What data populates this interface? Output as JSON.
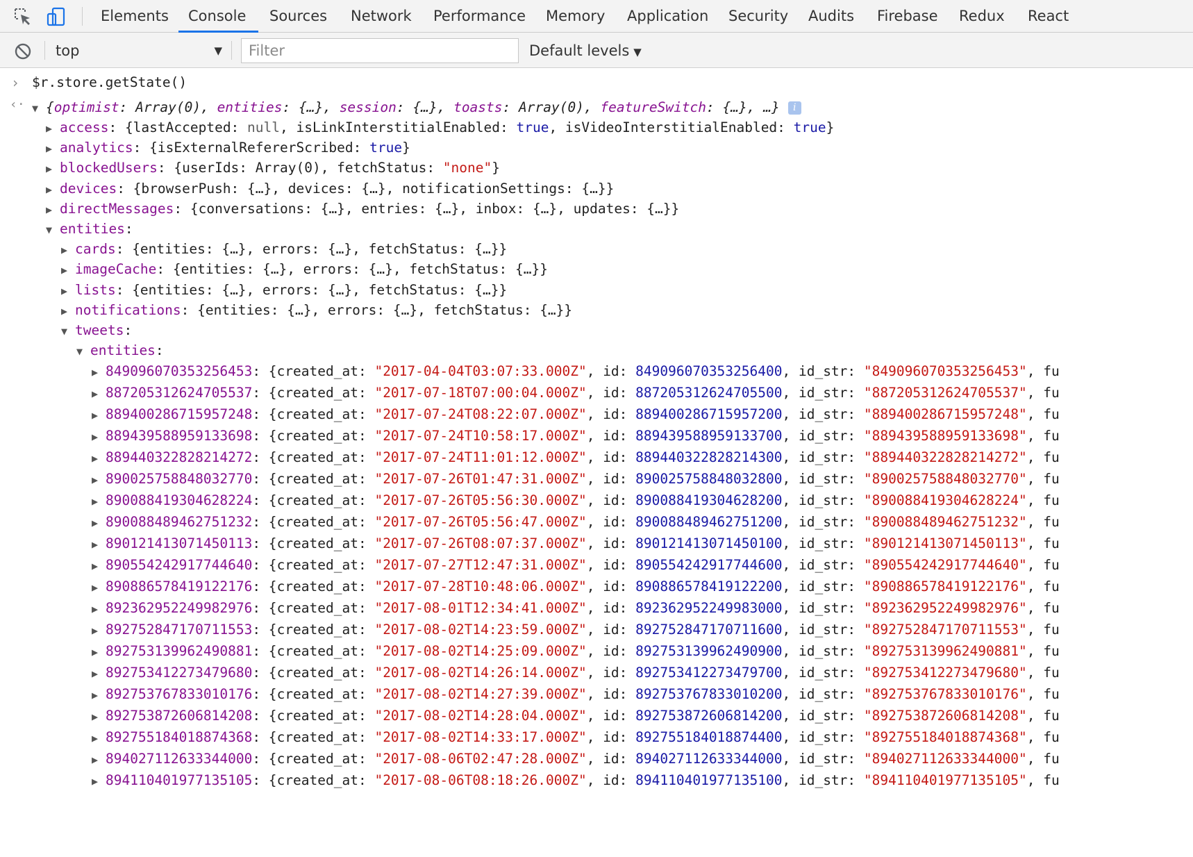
{
  "tabs": [
    "Elements",
    "Console",
    "Sources",
    "Network",
    "Performance",
    "Memory",
    "Application",
    "Security",
    "Audits",
    "Firebase",
    "Redux",
    "React"
  ],
  "active_tab": "Console",
  "toolbar": {
    "context": "top",
    "filter_placeholder": "Filter",
    "levels": "Default levels"
  },
  "command": "$r.store.getState()",
  "summary": {
    "open": "{",
    "parts": [
      {
        "key": "optimist",
        "val": "Array(0)"
      },
      {
        "key": "entities",
        "val": "{…}"
      },
      {
        "key": "session",
        "val": "{…}"
      },
      {
        "key": "toasts",
        "val": "Array(0)"
      },
      {
        "key": "featureSwitch",
        "val": "{…}"
      }
    ],
    "close": ", …}"
  },
  "top_props": [
    {
      "key": "access",
      "text": "{lastAccepted: null, isLinkInterstitialEnabled: true, isVideoInterstitialEnabled: true}"
    },
    {
      "key": "analytics",
      "text": "{isExternalRefererScribed: true}"
    },
    {
      "key": "blockedUsers",
      "text": "{userIds: Array(0), fetchStatus: \"none\"}"
    },
    {
      "key": "devices",
      "text": "{browserPush: {…}, devices: {…}, notificationSettings: {…}}"
    },
    {
      "key": "directMessages",
      "text": "{conversations: {…}, entries: {…}, inbox: {…}, updates: {…}}"
    }
  ],
  "entities_label": "entities",
  "entity_children": [
    {
      "key": "cards",
      "text": "{entities: {…}, errors: {…}, fetchStatus: {…}}"
    },
    {
      "key": "imageCache",
      "text": "{entities: {…}, errors: {…}, fetchStatus: {…}}"
    },
    {
      "key": "lists",
      "text": "{entities: {…}, errors: {…}, fetchStatus: {…}}"
    },
    {
      "key": "notifications",
      "text": "{entities: {…}, errors: {…}, fetchStatus: {…}}"
    }
  ],
  "tweets_label": "tweets",
  "tweets_entities_label": "entities",
  "tweets": [
    {
      "key": "849096070353256453",
      "created_at": "\"2017-04-04T03:07:33.000Z\"",
      "id": "849096070353256400",
      "id_str": "\"849096070353256453\""
    },
    {
      "key": "887205312624705537",
      "created_at": "\"2017-07-18T07:00:04.000Z\"",
      "id": "887205312624705500",
      "id_str": "\"887205312624705537\""
    },
    {
      "key": "889400286715957248",
      "created_at": "\"2017-07-24T08:22:07.000Z\"",
      "id": "889400286715957200",
      "id_str": "\"889400286715957248\""
    },
    {
      "key": "889439588959133698",
      "created_at": "\"2017-07-24T10:58:17.000Z\"",
      "id": "889439588959133700",
      "id_str": "\"889439588959133698\""
    },
    {
      "key": "889440322828214272",
      "created_at": "\"2017-07-24T11:01:12.000Z\"",
      "id": "889440322828214300",
      "id_str": "\"889440322828214272\""
    },
    {
      "key": "890025758848032770",
      "created_at": "\"2017-07-26T01:47:31.000Z\"",
      "id": "890025758848032800",
      "id_str": "\"890025758848032770\""
    },
    {
      "key": "890088419304628224",
      "created_at": "\"2017-07-26T05:56:30.000Z\"",
      "id": "890088419304628200",
      "id_str": "\"890088419304628224\""
    },
    {
      "key": "890088489462751232",
      "created_at": "\"2017-07-26T05:56:47.000Z\"",
      "id": "890088489462751200",
      "id_str": "\"890088489462751232\""
    },
    {
      "key": "890121413071450113",
      "created_at": "\"2017-07-26T08:07:37.000Z\"",
      "id": "890121413071450100",
      "id_str": "\"890121413071450113\""
    },
    {
      "key": "890554242917744640",
      "created_at": "\"2017-07-27T12:47:31.000Z\"",
      "id": "890554242917744600",
      "id_str": "\"890554242917744640\""
    },
    {
      "key": "890886578419122176",
      "created_at": "\"2017-07-28T10:48:06.000Z\"",
      "id": "890886578419122200",
      "id_str": "\"890886578419122176\""
    },
    {
      "key": "892362952249982976",
      "created_at": "\"2017-08-01T12:34:41.000Z\"",
      "id": "892362952249983000",
      "id_str": "\"892362952249982976\""
    },
    {
      "key": "892752847170711553",
      "created_at": "\"2017-08-02T14:23:59.000Z\"",
      "id": "892752847170711600",
      "id_str": "\"892752847170711553\""
    },
    {
      "key": "892753139962490881",
      "created_at": "\"2017-08-02T14:25:09.000Z\"",
      "id": "892753139962490900",
      "id_str": "\"892753139962490881\""
    },
    {
      "key": "892753412273479680",
      "created_at": "\"2017-08-02T14:26:14.000Z\"",
      "id": "892753412273479700",
      "id_str": "\"892753412273479680\""
    },
    {
      "key": "892753767833010176",
      "created_at": "\"2017-08-02T14:27:39.000Z\"",
      "id": "892753767833010200",
      "id_str": "\"892753767833010176\""
    },
    {
      "key": "892753872606814208",
      "created_at": "\"2017-08-02T14:28:04.000Z\"",
      "id": "892753872606814200",
      "id_str": "\"892753872606814208\""
    },
    {
      "key": "892755184018874368",
      "created_at": "\"2017-08-02T14:33:17.000Z\"",
      "id": "892755184018874400",
      "id_str": "\"892755184018874368\""
    },
    {
      "key": "894027112633344000",
      "created_at": "\"2017-08-06T02:47:28.000Z\"",
      "id": "894027112633344000",
      "id_str": "\"894027112633344000\""
    },
    {
      "key": "894110401977135105",
      "created_at": "\"2017-08-06T08:18:26.000Z\"",
      "id": "894110401977135100",
      "id_str": "\"894110401977135105\""
    }
  ],
  "labels": {
    "created_at": "created_at",
    "id": "id",
    "id_str": "id_str",
    "trailing": "fu"
  },
  "colors": {
    "accent": "#1a73e8",
    "key": "#881391",
    "string": "#c41a16",
    "number": "#1a1aa6"
  },
  "icons": [
    "inspect-element-icon",
    "device-toolbar-icon",
    "clear-console-icon",
    "info-icon"
  ]
}
